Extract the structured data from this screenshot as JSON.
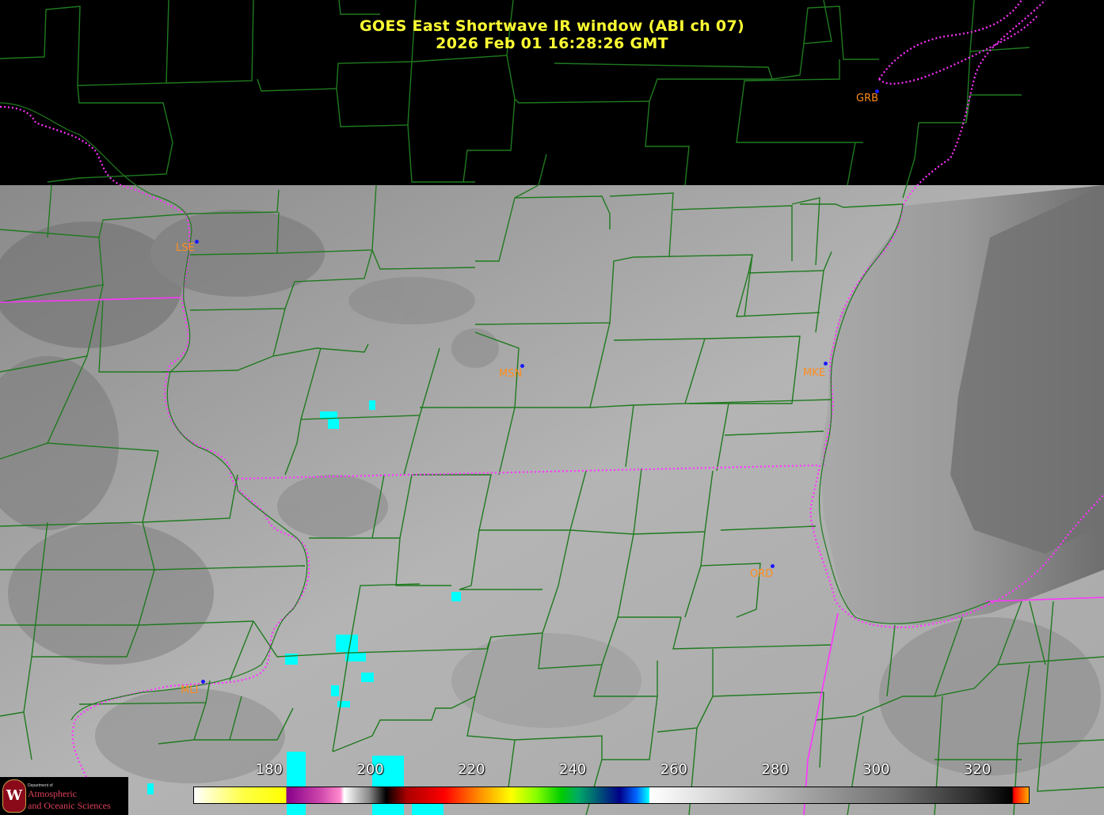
{
  "title": {
    "line1": "GOES East Shortwave IR window (ABI ch 07)",
    "line2": "2026 Feb 01  16:28:26 GMT"
  },
  "stations": [
    {
      "code": "LSE"
    },
    {
      "code": "MSN"
    },
    {
      "code": "MKE"
    },
    {
      "code": "ORD"
    },
    {
      "code": "MLI"
    },
    {
      "code": "GRB"
    }
  ],
  "colorbar": {
    "ticks": [
      "180",
      "200",
      "220",
      "240",
      "260",
      "280",
      "300",
      "320"
    ],
    "tick_values": [
      180,
      200,
      220,
      240,
      260,
      280,
      300,
      320
    ],
    "range": [
      165,
      330
    ]
  },
  "logo": {
    "emblem": "W",
    "line1": "Department of",
    "line2": "Atmospheric",
    "line3": "and Oceanic Sciences"
  },
  "colors": {
    "title": "#ffff33",
    "county_lines": "#1f7a1f",
    "state_lines": "#ff33ff",
    "station_label": "#ff8c1a",
    "cold_cloud": "#00ffff"
  }
}
